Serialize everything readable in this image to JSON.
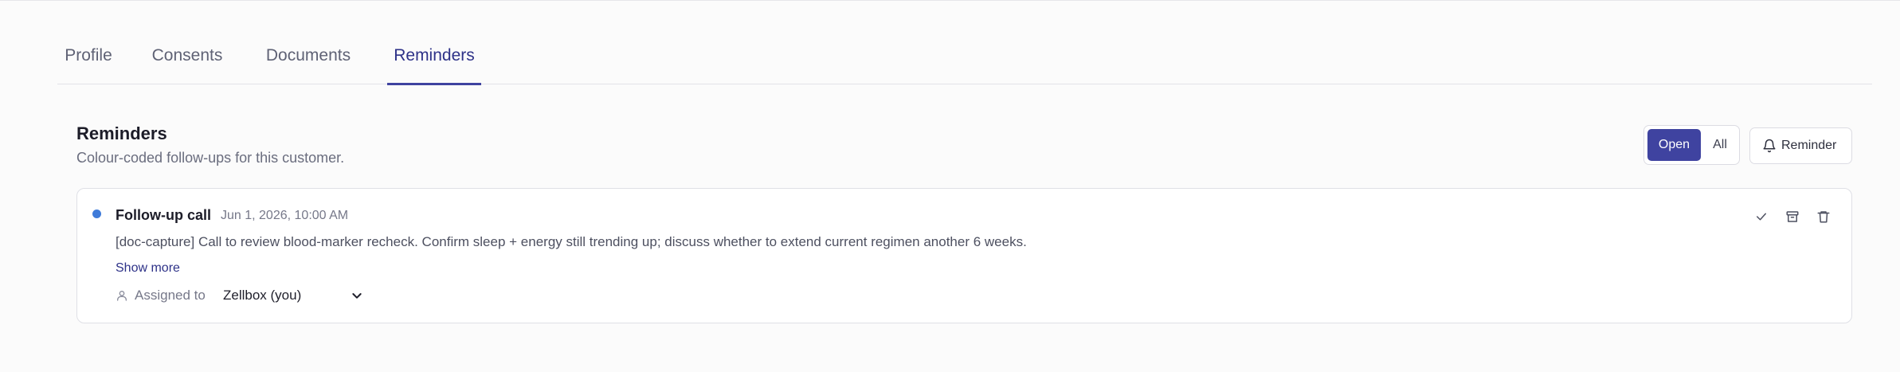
{
  "tabs": [
    {
      "label": "Profile"
    },
    {
      "label": "Consents"
    },
    {
      "label": "Documents"
    },
    {
      "label": "Reminders",
      "active": true
    }
  ],
  "section": {
    "title": "Reminders",
    "subtitle": "Colour-coded follow-ups for this customer."
  },
  "filters": {
    "open_label": "Open",
    "all_label": "All",
    "selected": "Open"
  },
  "add_button": {
    "label": "Reminder",
    "icon": "bell-icon"
  },
  "reminders": [
    {
      "title": "Follow-up call",
      "datetime": "Jun 1, 2026, 10:00 AM",
      "text": "[doc-capture] Call to review blood-marker recheck. Confirm sleep + energy still trending up; discuss whether to extend current regimen another 6 weeks.",
      "show_more": "Show more",
      "assigned_label": "Assigned to",
      "assignee": "Zellbox (you)",
      "dot_color": "#3f7bd9",
      "actions": [
        "check-icon",
        "archive-icon",
        "trash-icon"
      ]
    }
  ],
  "colors": {
    "accent": "#3f43a0",
    "link": "#2e3288",
    "status_dot": "#3f7bd9"
  }
}
